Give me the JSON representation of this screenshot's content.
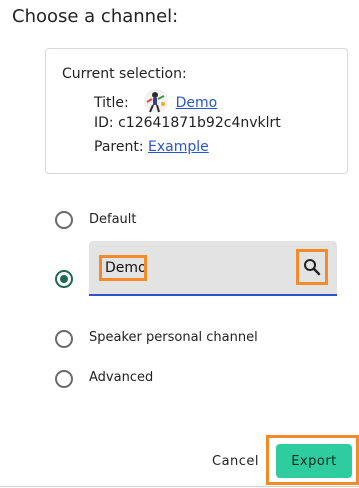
{
  "dialog": {
    "title": "Choose a channel:"
  },
  "current_selection": {
    "heading": "Current selection:",
    "title_label": "Title:",
    "title_value": "Demo",
    "id_label": "ID:",
    "id_value": "c12641871b92c4nvklrt",
    "parent_label": "Parent:",
    "parent_value": "Example"
  },
  "options": {
    "default_label": "Default",
    "search_value": "Demo",
    "speaker_label": "Speaker personal channel",
    "advanced_label": "Advanced",
    "selected": "search"
  },
  "actions": {
    "cancel_label": "Cancel",
    "export_label": "Export"
  },
  "colors": {
    "accent": "#2ecc9e",
    "radio_selected": "#1e6b52",
    "link": "#2a56c6",
    "highlight": "#f28c28"
  },
  "icons": {
    "search": "search-icon",
    "thumbnail": "channel-thumbnail"
  }
}
